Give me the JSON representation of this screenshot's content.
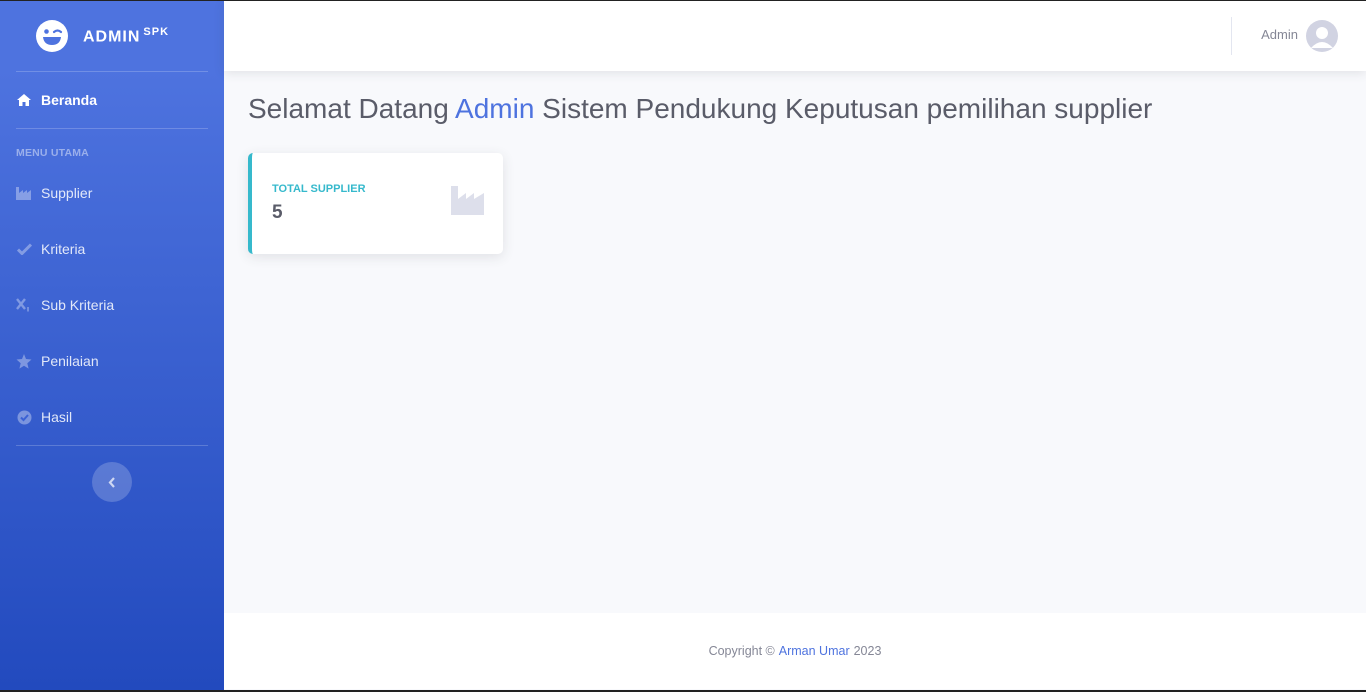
{
  "brand": {
    "name": "ADMIN",
    "sup": "SPK",
    "icon": "laugh-wink-icon"
  },
  "sidebar": {
    "items_top": [
      {
        "label": "Beranda",
        "icon": "home-icon",
        "active": true
      }
    ],
    "heading": "MENU UTAMA",
    "items": [
      {
        "label": "Supplier",
        "icon": "industry-icon"
      },
      {
        "label": "Kriteria",
        "icon": "check-icon"
      },
      {
        "label": "Sub Kriteria",
        "icon": "subscript-icon"
      },
      {
        "label": "Penilaian",
        "icon": "star-icon"
      },
      {
        "label": "Hasil",
        "icon": "check-circle-icon"
      }
    ],
    "toggle_icon": "chevron-left-icon"
  },
  "topbar": {
    "user_name": "Admin",
    "avatar_icon": "user-avatar-icon"
  },
  "main": {
    "title_pre": "Selamat Datang ",
    "title_highlight": "Admin",
    "title_post": " Sistem Pendukung Keputusan pemilihan supplier",
    "card": {
      "label": "TOTAL SUPPLIER",
      "value": "5",
      "icon": "industry-icon"
    }
  },
  "footer": {
    "pre": "Copyright ©",
    "author": "Arman Umar",
    "year": "2023"
  },
  "colors": {
    "primary": "#4e73df",
    "info": "#36b9cc",
    "text": "#5a5c69",
    "muted": "#858796"
  }
}
